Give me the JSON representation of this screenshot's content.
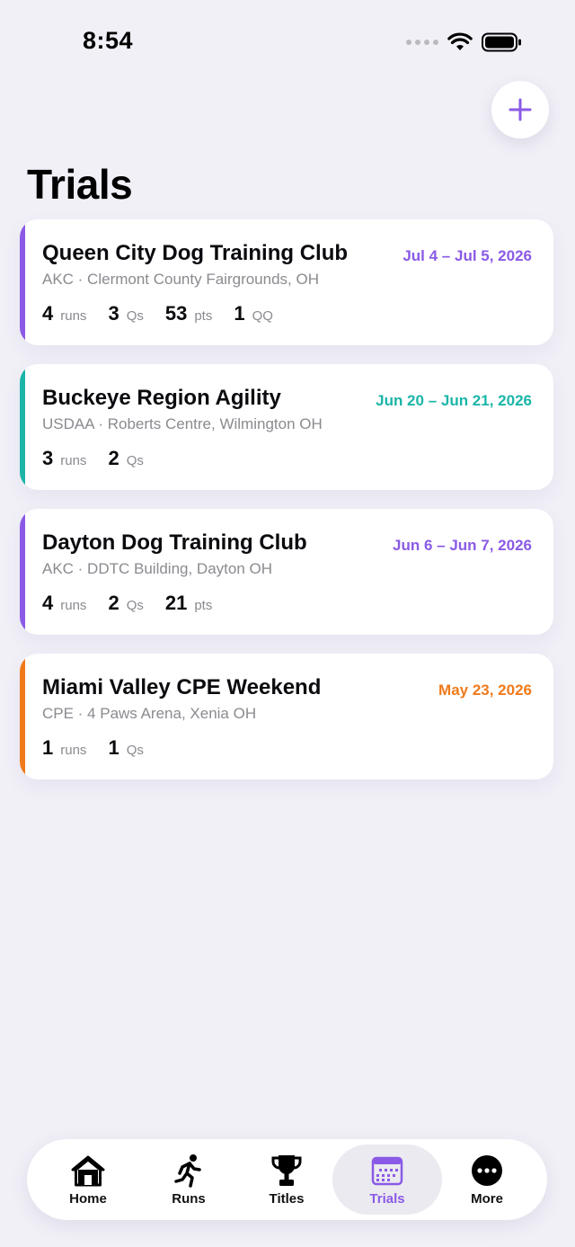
{
  "status_bar": {
    "time": "8:54"
  },
  "header": {
    "title": "Trials",
    "add_icon": "plus-icon"
  },
  "colors": {
    "purple": "#8a5ae6",
    "teal": "#1bb5a8",
    "orange": "#f07a1a"
  },
  "trials": [
    {
      "name": "Queen City Dog Training Club",
      "dates": "Jul 4 – Jul 5, 2026",
      "subtitle": "AKC · Clermont County Fairgrounds, OH",
      "accent": "#8a5ae6",
      "stats": [
        {
          "num": "4",
          "unit": "runs"
        },
        {
          "num": "3",
          "unit": "Qs"
        },
        {
          "num": "53",
          "unit": "pts"
        },
        {
          "num": "1",
          "unit": "QQ"
        }
      ]
    },
    {
      "name": "Buckeye Region Agility",
      "dates": "Jun 20 – Jun 21, 2026",
      "subtitle": "USDAA · Roberts Centre, Wilmington OH",
      "accent": "#1bb5a8",
      "stats": [
        {
          "num": "3",
          "unit": "runs"
        },
        {
          "num": "2",
          "unit": "Qs"
        }
      ]
    },
    {
      "name": "Dayton Dog Training Club",
      "dates": "Jun 6 – Jun 7, 2026",
      "subtitle": "AKC · DDTC Building, Dayton OH",
      "accent": "#8a5ae6",
      "stats": [
        {
          "num": "4",
          "unit": "runs"
        },
        {
          "num": "2",
          "unit": "Qs"
        },
        {
          "num": "21",
          "unit": "pts"
        }
      ]
    },
    {
      "name": "Miami Valley CPE Weekend",
      "dates": "May 23, 2026",
      "subtitle": "CPE · 4 Paws Arena, Xenia OH",
      "accent": "#f07a1a",
      "stats": [
        {
          "num": "1",
          "unit": "runs"
        },
        {
          "num": "1",
          "unit": "Qs"
        }
      ]
    }
  ],
  "tab_bar": {
    "items": [
      {
        "label": "Home",
        "icon": "home-icon"
      },
      {
        "label": "Runs",
        "icon": "runner-icon"
      },
      {
        "label": "Titles",
        "icon": "trophy-icon"
      },
      {
        "label": "Trials",
        "icon": "calendar-icon",
        "active": true
      },
      {
        "label": "More",
        "icon": "more-icon"
      }
    ]
  }
}
